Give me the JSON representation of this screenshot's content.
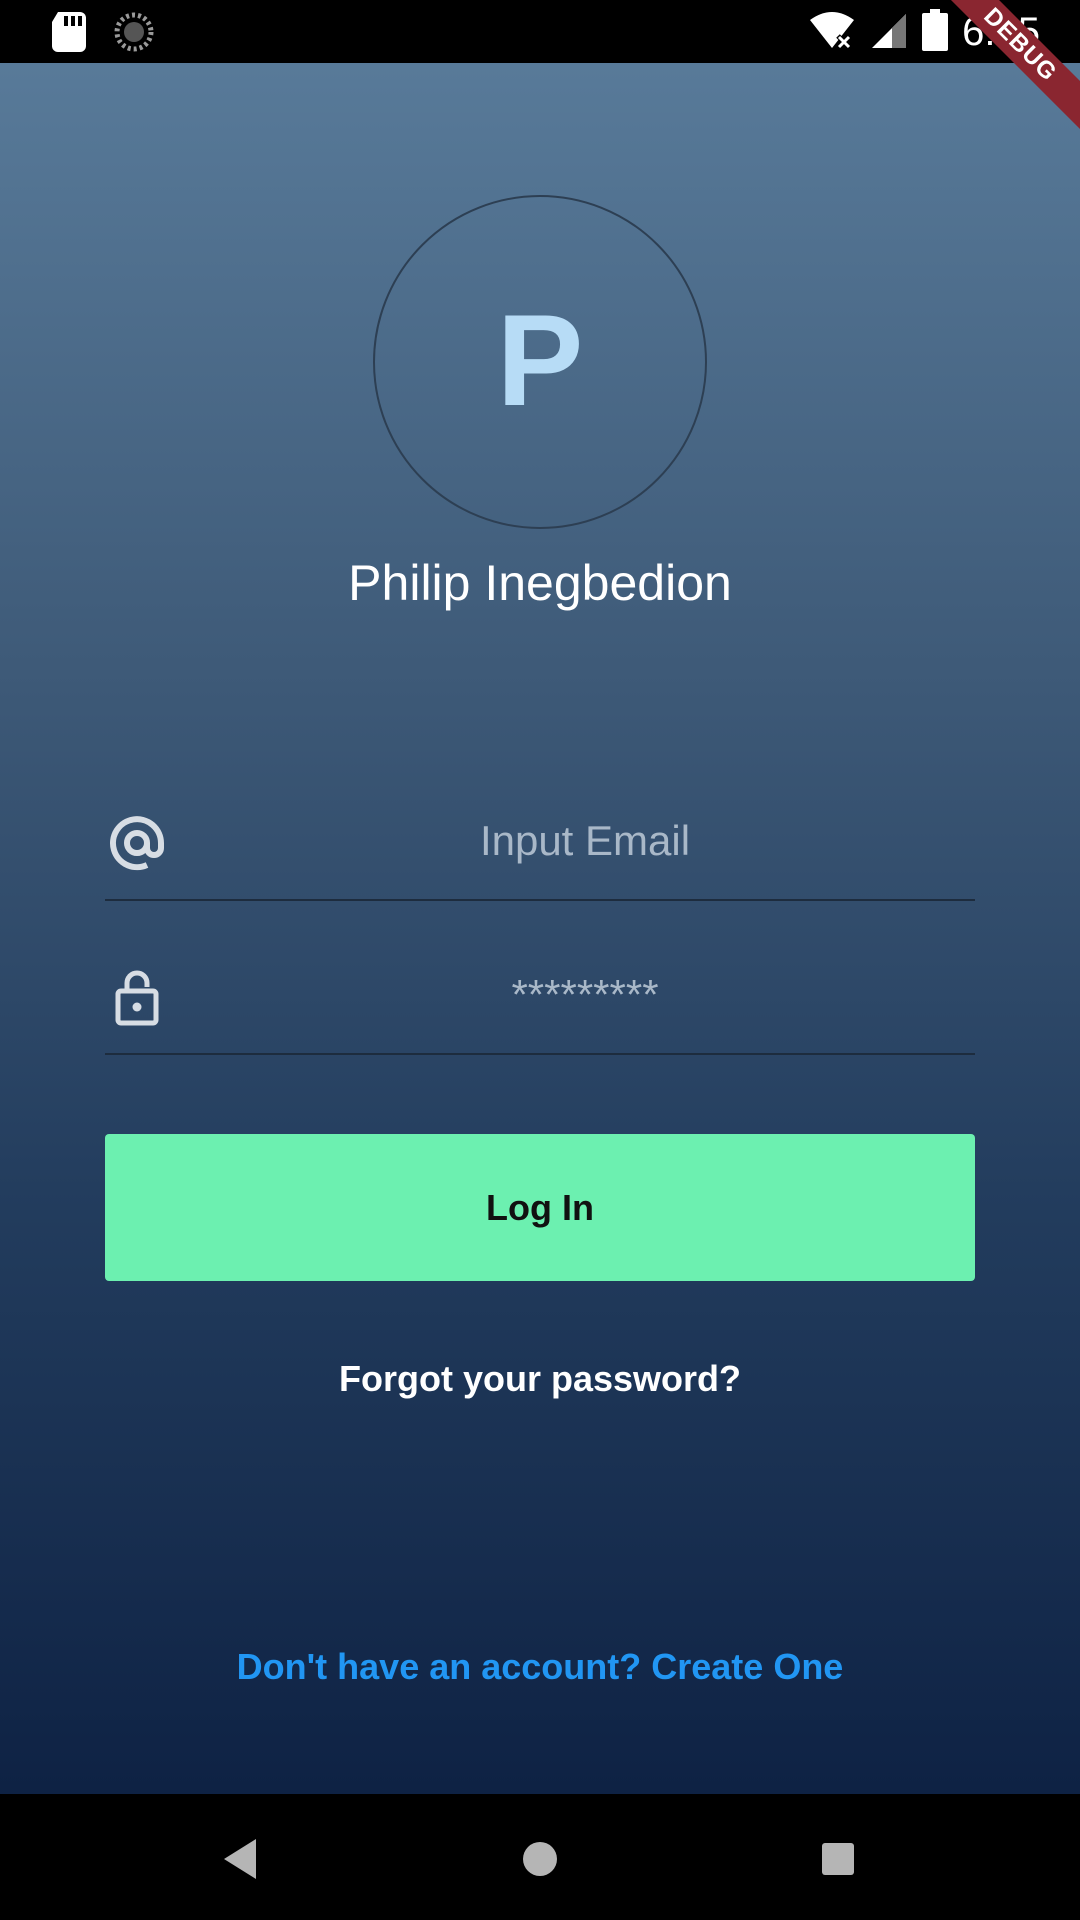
{
  "status_bar": {
    "time": "6:35",
    "icons": [
      "sd-card-icon",
      "sync-icon",
      "wifi-off-icon",
      "signal-icon",
      "battery-icon"
    ]
  },
  "debug_banner": {
    "label": "DEBUG"
  },
  "profile": {
    "initial": "P",
    "name": "Philip Inegbedion"
  },
  "form": {
    "email": {
      "placeholder": "Input Email",
      "value": ""
    },
    "password": {
      "placeholder": "*********",
      "value": ""
    },
    "login_label": "Log In",
    "forgot_label": "Forgot your password?",
    "signup_label": "Don't have an account? Create One"
  },
  "nav": {
    "items": [
      "back-icon",
      "home-icon",
      "recents-icon"
    ]
  },
  "colors": {
    "login_button": "#6cf0b0",
    "link": "#2196f3",
    "avatar_letter": "#b7dcf6",
    "gradient_top": "#587a99",
    "gradient_bottom": "#0e2244"
  }
}
